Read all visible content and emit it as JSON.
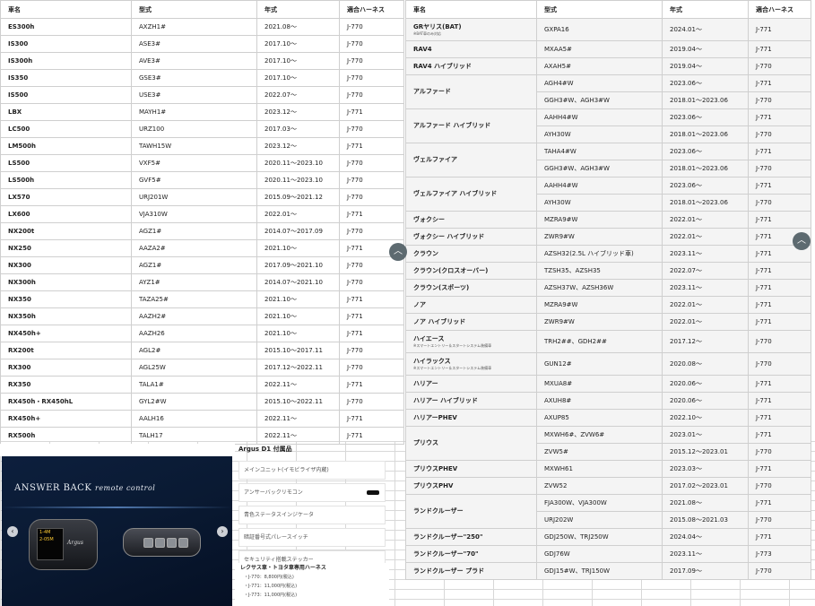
{
  "headers": {
    "name": "車名",
    "model": "型式",
    "year": "年式",
    "harness": "適合ハーネス"
  },
  "left_rows": [
    {
      "name": "ES300h",
      "model": "AXZH1#",
      "year": "2021.08～",
      "harness": "J-770"
    },
    {
      "name": "IS300",
      "model": "ASE3#",
      "year": "2017.10～",
      "harness": "J-770"
    },
    {
      "name": "IS300h",
      "model": "AVE3#",
      "year": "2017.10～",
      "harness": "J-770"
    },
    {
      "name": "IS350",
      "model": "GSE3#",
      "year": "2017.10～",
      "harness": "J-770"
    },
    {
      "name": "IS500",
      "model": "USE3#",
      "year": "2022.07～",
      "harness": "J-770"
    },
    {
      "name": "LBX",
      "model": "MAYH1#",
      "year": "2023.12～",
      "harness": "J-771"
    },
    {
      "name": "LC500",
      "model": "URZ100",
      "year": "2017.03～",
      "harness": "J-770"
    },
    {
      "name": "LM500h",
      "model": "TAWH15W",
      "year": "2023.12～",
      "harness": "J-771"
    },
    {
      "name": "LS500",
      "model": "VXF5#",
      "year": "2020.11～2023.10",
      "harness": "J-770"
    },
    {
      "name": "LS500h",
      "model": "GVF5#",
      "year": "2020.11～2023.10",
      "harness": "J-770"
    },
    {
      "name": "LX570",
      "model": "URJ201W",
      "year": "2015.09～2021.12",
      "harness": "J-770"
    },
    {
      "name": "LX600",
      "model": "VJA310W",
      "year": "2022.01～",
      "harness": "J-771"
    },
    {
      "name": "NX200t",
      "model": "AGZ1#",
      "year": "2014.07～2017.09",
      "harness": "J-770"
    },
    {
      "name": "NX250",
      "model": "AAZA2#",
      "year": "2021.10～",
      "harness": "J-771"
    },
    {
      "name": "NX300",
      "model": "AGZ1#",
      "year": "2017.09～2021.10",
      "harness": "J-770"
    },
    {
      "name": "NX300h",
      "model": "AYZ1#",
      "year": "2014.07～2021.10",
      "harness": "J-770"
    },
    {
      "name": "NX350",
      "model": "TAZA25#",
      "year": "2021.10～",
      "harness": "J-771"
    },
    {
      "name": "NX350h",
      "model": "AAZH2#",
      "year": "2021.10～",
      "harness": "J-771"
    },
    {
      "name": "NX450h+",
      "model": "AAZH26",
      "year": "2021.10～",
      "harness": "J-771"
    },
    {
      "name": "RX200t",
      "model": "AGL2#",
      "year": "2015.10～2017.11",
      "harness": "J-770"
    },
    {
      "name": "RX300",
      "model": "AGL25W",
      "year": "2017.12～2022.11",
      "harness": "J-770"
    },
    {
      "name": "RX350",
      "model": "TALA1#",
      "year": "2022.11～",
      "harness": "J-771"
    },
    {
      "name": "RX450h・RX450hL",
      "model": "GYL2#W",
      "year": "2015.10～2022.11",
      "harness": "J-770"
    },
    {
      "name": "RX450h+",
      "model": "AALH16",
      "year": "2022.11～",
      "harness": "J-771"
    },
    {
      "name": "RX500h",
      "model": "TALH17",
      "year": "2022.11～",
      "harness": "J-771"
    }
  ],
  "right_rows": [
    {
      "name": "GRヤリス(BAT)",
      "note": "※BAT車のみ対応",
      "model": "GXPA16",
      "year": "2024.01～",
      "harness": "J-771"
    },
    {
      "name": "RAV4",
      "model": "MXAA5#",
      "year": "2019.04～",
      "harness": "J-771"
    },
    {
      "name": "RAV4 ハイブリッド",
      "model": "AXAH5#",
      "year": "2019.04～",
      "harness": "J-770"
    },
    {
      "name": "アルファード",
      "model": "AGH4#W",
      "year": "2023.06～",
      "harness": "J-771"
    },
    {
      "name": "",
      "model": "GGH3#W、AGH3#W",
      "year": "2018.01～2023.06",
      "harness": "J-770"
    },
    {
      "name": "アルファード ハイブリッド",
      "model": "AAHH4#W",
      "year": "2023.06～",
      "harness": "J-771"
    },
    {
      "name": "",
      "model": "AYH30W",
      "year": "2018.01～2023.06",
      "harness": "J-770"
    },
    {
      "name": "ヴェルファイア",
      "model": "TAHA4#W",
      "year": "2023.06～",
      "harness": "J-771"
    },
    {
      "name": "",
      "model": "GGH3#W、AGH3#W",
      "year": "2018.01～2023.06",
      "harness": "J-770"
    },
    {
      "name": "ヴェルファイア ハイブリッド",
      "model": "AAHH4#W",
      "year": "2023.06～",
      "harness": "J-771"
    },
    {
      "name": "",
      "model": "AYH30W",
      "year": "2018.01～2023.06",
      "harness": "J-770"
    },
    {
      "name": "ヴォクシー",
      "model": "MZRA9#W",
      "year": "2022.01～",
      "harness": "J-771"
    },
    {
      "name": "ヴォクシー ハイブリッド",
      "model": "ZWR9#W",
      "year": "2022.01～",
      "harness": "J-771"
    },
    {
      "name": "クラウン",
      "model": "AZSH32(2.5L ハイブリッド車)",
      "year": "2023.11～",
      "harness": "J-771"
    },
    {
      "name": "クラウン(クロスオーバー)",
      "model": "TZSH35、AZSH35",
      "year": "2022.07～",
      "harness": "J-771"
    },
    {
      "name": "クラウン(スポーツ)",
      "model": "AZSH37W、AZSH36W",
      "year": "2023.11～",
      "harness": "J-771"
    },
    {
      "name": "ノア",
      "model": "MZRA9#W",
      "year": "2022.01～",
      "harness": "J-771"
    },
    {
      "name": "ノア ハイブリッド",
      "model": "ZWR9#W",
      "year": "2022.01～",
      "harness": "J-771"
    },
    {
      "name": "ハイエース",
      "note": "※スマートエントリー＆スタートシステム装備車",
      "model": "TRH2##、GDH2##",
      "year": "2017.12～",
      "harness": "J-770"
    },
    {
      "name": "ハイラックス",
      "note": "※スマートエントリー＆スタートシステム装備車",
      "model": "GUN12#",
      "year": "2020.08～",
      "harness": "J-770"
    },
    {
      "name": "ハリアー",
      "model": "MXUA8#",
      "year": "2020.06～",
      "harness": "J-771"
    },
    {
      "name": "ハリアー ハイブリッド",
      "model": "AXUH8#",
      "year": "2020.06～",
      "harness": "J-771"
    },
    {
      "name": "ハリアーPHEV",
      "model": "AXUP85",
      "year": "2022.10～",
      "harness": "J-771"
    },
    {
      "name": "プリウス",
      "model": "MXWH6#、ZVW6#",
      "year": "2023.01～",
      "harness": "J-771"
    },
    {
      "name": "",
      "model": "ZVW5#",
      "year": "2015.12～2023.01",
      "harness": "J-770"
    },
    {
      "name": "プリウスPHEV",
      "model": "MXWH61",
      "year": "2023.03～",
      "harness": "J-771"
    },
    {
      "name": "プリウスPHV",
      "model": "ZVW52",
      "year": "2017.02～2023.01",
      "harness": "J-770"
    },
    {
      "name": "ランドクルーザー",
      "model": "FJA300W、VJA300W",
      "year": "2021.08～",
      "harness": "J-771"
    },
    {
      "name": "",
      "model": "URJ202W",
      "year": "2015.08～2021.03",
      "harness": "J-770"
    },
    {
      "name": "ランドクルーザー\"250\"",
      "model": "GDJ250W、TRJ250W",
      "year": "2024.04～",
      "harness": "J-771"
    },
    {
      "name": "ランドクルーザー\"70\"",
      "model": "GDJ76W",
      "year": "2023.11～",
      "harness": "J-773"
    },
    {
      "name": "ランドクルーザー プラド",
      "model": "GDJ15#W、TRJ150W",
      "year": "2017.09～",
      "harness": "J-770"
    }
  ],
  "accessories": {
    "title": "Argus D1 付属品",
    "items": [
      "メインユニット(イモビライザ内蔵)",
      "アンサーバックリモコン",
      "青色ステータスインジケータ",
      "暗証番号式パレースイッチ",
      "セキュリティ搭載ステッカー"
    ]
  },
  "harness_info": {
    "title": "レクサス車・トヨタ車専用ハーネス",
    "lines": [
      "・J-770：8,800円(税込)",
      "・J-771：11,000円(税込)",
      "・J-773：11,000円(税込)"
    ]
  },
  "banner": {
    "title": "ANSWER BACK",
    "subtitle": "remote control",
    "screen_lines": [
      "1-4M",
      "2-05M"
    ],
    "remote_brand": "Argus"
  },
  "colors": {
    "banner_bg": "#0a1a33",
    "grid": "#d8d8d8",
    "row_alt": "#f4f4f4",
    "scroll_button": "#5d6a70"
  }
}
